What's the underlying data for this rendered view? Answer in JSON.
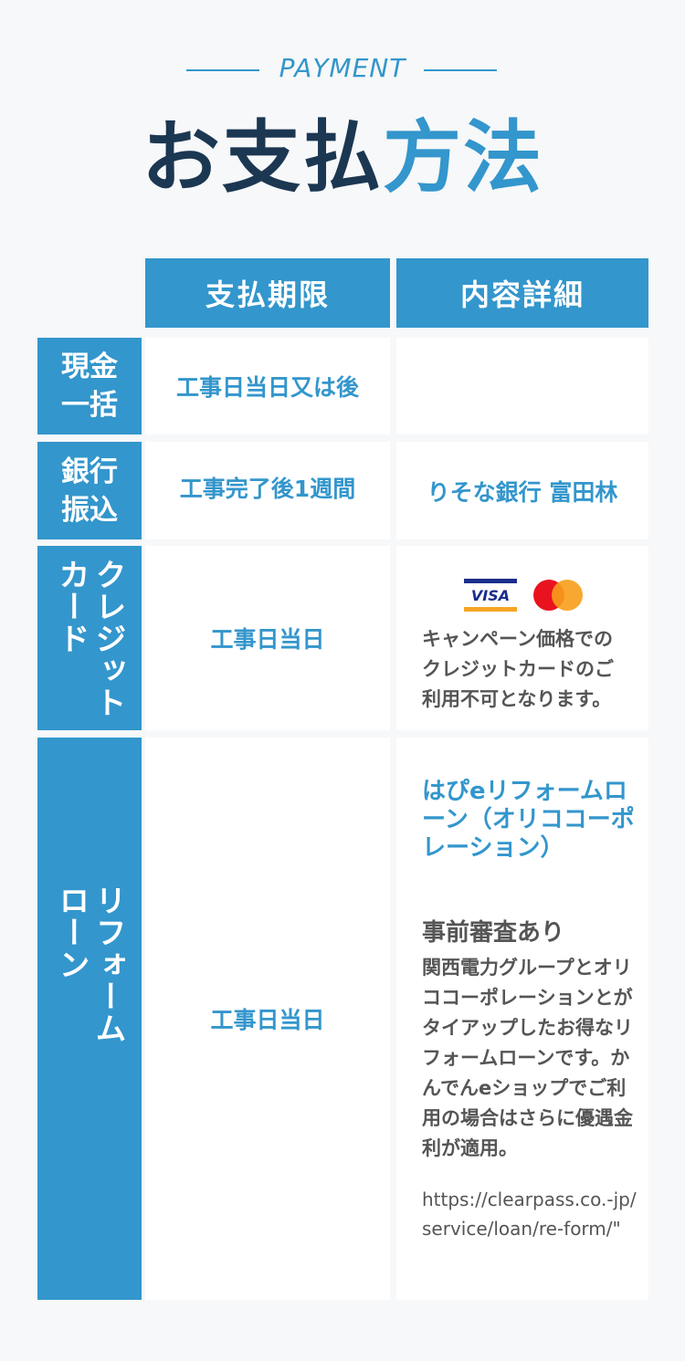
{
  "header": {
    "eyebrow": "PAYMENT",
    "title_dark": "お支払",
    "title_blue": "方法"
  },
  "table": {
    "col_deadline": "支払期限",
    "col_detail": "内容詳細",
    "rows": [
      {
        "label": "現金一括",
        "label_line1": "現金",
        "label_line2": "一括",
        "deadline": "工事日当日又は後",
        "detail": ""
      },
      {
        "label": "銀行振込",
        "label_line1": "銀行",
        "label_line2": "振込",
        "deadline": "工事完了後1週間",
        "detail": "りそな銀行 富田林"
      },
      {
        "label": "クレジットカード",
        "label_col1": "クレジット",
        "label_col2": "カード",
        "deadline": "工事日当日",
        "card_brands": [
          "VISA",
          "Mastercard"
        ],
        "detail": "キャンペーン価格でのクレジットカードのご利用不可となります。"
      },
      {
        "label": "リフォームローン",
        "label_col1": "リフォーム",
        "label_col2": "ローン",
        "deadline": "工事日当日",
        "loan_title": "はぴeリフォームローン（オリココーポレーション）",
        "loan_head": "事前審査あり",
        "loan_body": "関西電力グループとオリココーポレーションとがタイアップしたお得なリフォームローンです。かんでんeショップでご利用の場合はさらに優遇金利が適用。",
        "loan_url": "https://clearpass.co.-jp/service/loan/re-form/\""
      }
    ]
  },
  "colors": {
    "accent": "#3396cc",
    "title_dark": "#1b3752",
    "body_text": "#555555",
    "background": "#f7f8f9"
  }
}
